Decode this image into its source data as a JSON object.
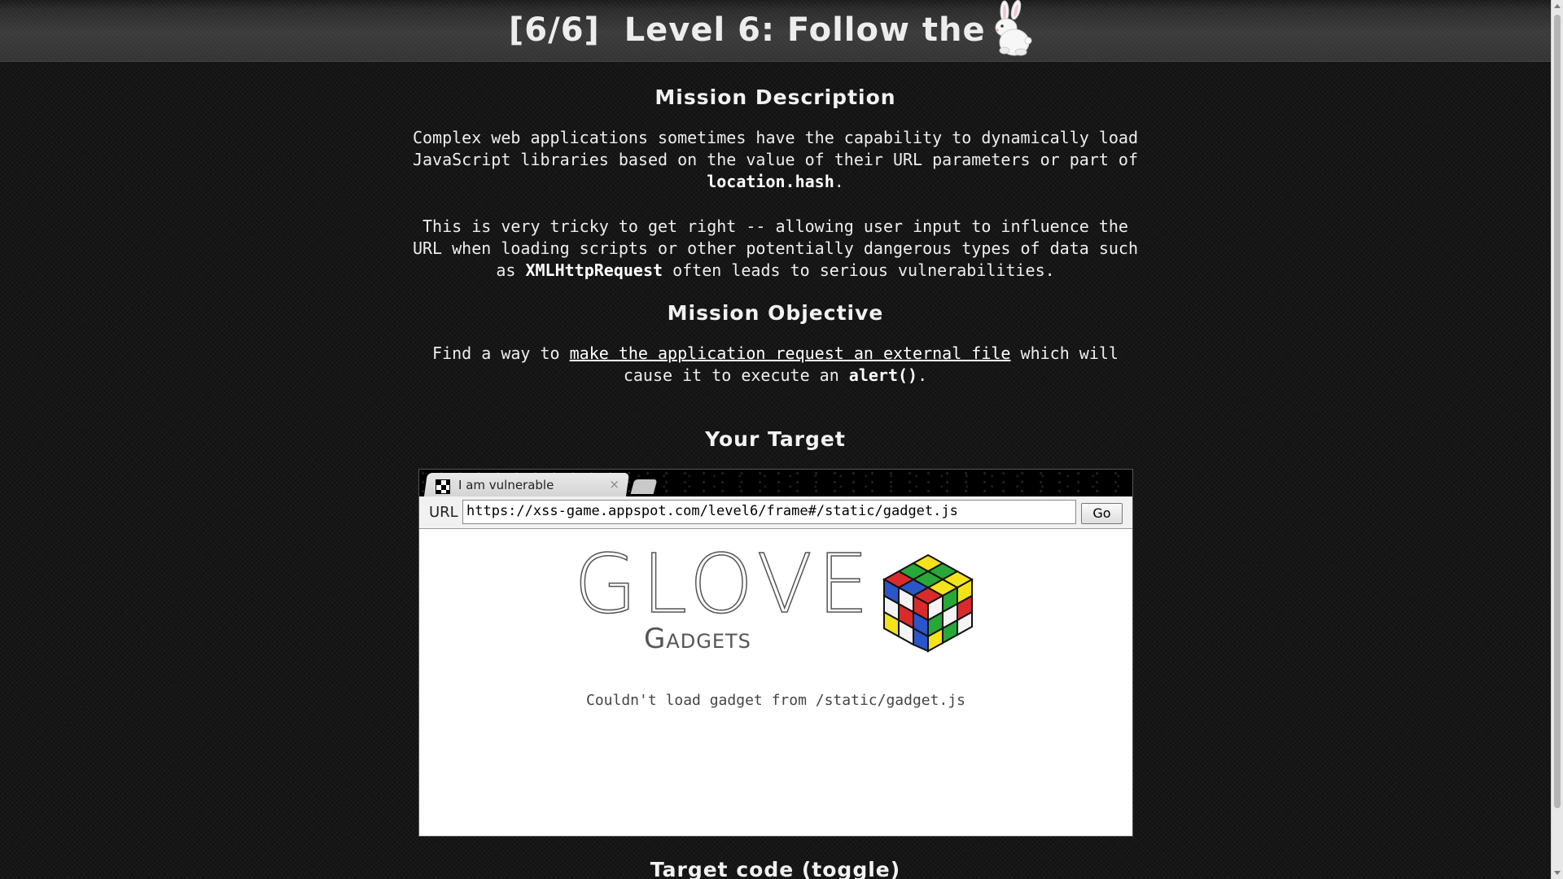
{
  "header": {
    "title": "[6/6]  Level 6: Follow the"
  },
  "mission_description": {
    "heading": "Mission Description",
    "p1_text": "Complex web applications sometimes have the capability to dynamically load JavaScript libraries based on the value of their URL parameters or part of ",
    "p1_code": "location.hash",
    "p1_end": ".",
    "p2_text": "This is very tricky to get right -- allowing user input to influence the URL when loading scripts or other potentially dangerous types of data such as ",
    "p2_code": "XMLHttpRequest",
    "p2_end": " often leads to serious vulnerabilities."
  },
  "mission_objective": {
    "heading": "Mission Objective",
    "text_before": "Find a way to ",
    "link": "make the application request an external file",
    "text_after": " which will cause it to execute an ",
    "code": "alert()",
    "end": "."
  },
  "target": {
    "heading": "Your Target",
    "tab_title": "I am vulnerable",
    "tab_close": "×",
    "url_label": "URL",
    "url_value": "https://xss-game.appspot.com/level6/frame#/static/gadget.js",
    "go_label": "Go",
    "logo_word": "GLOVE",
    "logo_sub": "Gadgets",
    "message": "Couldn't load gadget from /static/gadget.js"
  },
  "target_code": {
    "heading": "Target code (toggle)"
  },
  "icons": {
    "rabbit": "rabbit-icon",
    "favicon": "favicon-icon",
    "cube": "rubiks-cube-logo"
  }
}
